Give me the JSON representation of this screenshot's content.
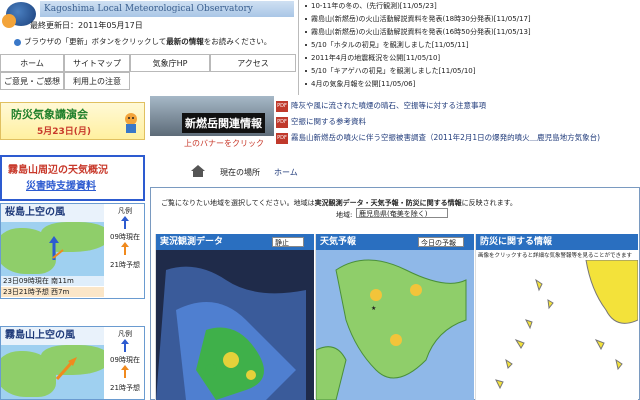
{
  "header": {
    "site_title": "Kagoshima Local Meteorological Observatory",
    "last_updated": "最終更新日：2011年05月17日",
    "reload_note": "ブラウザの「更新」ボタンをクリックして",
    "reload_emph": "最新の情報",
    "reload_tail": "をお読みください。"
  },
  "nav": [
    {
      "label": "ホーム"
    },
    {
      "label": "サイトマップ"
    },
    {
      "label": "気象庁HP"
    },
    {
      "label": "アクセス"
    },
    {
      "label": "ご意見・ご感想"
    },
    {
      "label": "利用上の注意"
    }
  ],
  "news": [
    "10-11年の冬の、(先行観測)[11/05/23]",
    "霧島山(新燃岳)の火山活動解説資料を発表(18時30分発表)[11/05/17]",
    "霧島山(新燃岳)の火山活動解説資料を発表(16時50分発表)[11/05/13]",
    "5/10「ホタルの初見」を観測しました[11/05/11]",
    "2011年4月の地震概況を公開[11/05/10]",
    "5/10「キアゲハの初見」を観測しました[11/05/10]",
    "4月の気象月報を公開[11/05/06]"
  ],
  "event": {
    "title": "防災気象講演会",
    "date": "5月23日(月)"
  },
  "kirishima": {
    "title": "霧島山周辺の天気概況",
    "subtitle": "災害時支援資料"
  },
  "wind": [
    {
      "title": "桜島上空の風",
      "legend": [
        "凡例",
        "09時現在",
        "21時予想"
      ],
      "rows": [
        "23日09時現在 南11m",
        "23日21時予想 西7m"
      ]
    },
    {
      "title": "霧島山上空の風",
      "legend": [
        "凡例",
        "09時現在",
        "21時予想"
      ],
      "rows": []
    }
  ],
  "volcano": {
    "title": "新燃岳関連情報",
    "note": "上のバナーをクリック"
  },
  "volcano_links": [
    "降灰や風に流された噴煙の晴石、空振等に対する注意事項",
    "空振に関する参考資料",
    "霧島山新燃岳の噴火に伴う空振被害調査（2011年2月1日の爆発的噴火＿鹿児島地方気象台)"
  ],
  "breadcrumb": {
    "label": "現在の場所",
    "home": "ホーム"
  },
  "main": {
    "note_pre": "ご覧になりたい地域を選択してください。地域は",
    "note_emph": "実況観測データ・天気予報・防災に関する情報",
    "note_post": "に反映されます。",
    "area_label": "地域:",
    "area_value": "鹿児島県(奄美を除く)",
    "panels": [
      {
        "title": "実況観測データ",
        "select": "静止",
        "color": "#2a6fc0"
      },
      {
        "title": "天気予報",
        "select": "今日の予報",
        "color": "#2a6fc0"
      },
      {
        "title": "防災に関する情報",
        "select": "",
        "color": "#2a6fc0",
        "sub": "画像をクリックすると詳細な気象警報等を見ることができます"
      }
    ]
  },
  "colors": {
    "accent": "#2a6fc0",
    "red": "#c8392b",
    "green": "#1f7f2a"
  }
}
